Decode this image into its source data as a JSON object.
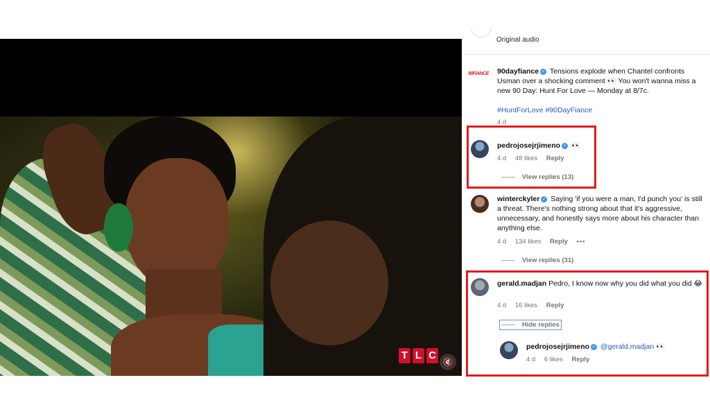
{
  "audio": {
    "label": "Original audio"
  },
  "video": {
    "badge_letters": [
      "T",
      "L",
      "C"
    ],
    "mute_icon": "muted-speaker-icon"
  },
  "caption": {
    "brand_avatar_text": "90FIANCE",
    "user": "90dayfiance",
    "text": "Tensions explode when Chantel confronts Usman over a shocking comment 👀 You won't wanna miss a new 90 Day: Hunt For Love — Monday at 8/7c.",
    "hashtags": "#HuntForLove #90DayFiance",
    "time": "4 d"
  },
  "comments": [
    {
      "user": "pedrojosejrjimeno",
      "text": "👀",
      "time": "4 d",
      "likes": "48 likes",
      "reply": "Reply",
      "replies_label": "View replies (13)"
    },
    {
      "user": "winterckyler",
      "text": "Saying 'if you were a man, I'd punch you' is still a threat. There's nothing strong about that it's aggressive, unnecessary, and honestly says more about his character than anything else.",
      "time": "4 d",
      "likes": "134 likes",
      "reply": "Reply",
      "more": "•••",
      "replies_label": "View replies (31)"
    },
    {
      "user": "gerald.madjan",
      "text": "Pedro, I know now why you did what you did 😂",
      "time": "4 d",
      "likes": "16 likes",
      "reply": "Reply",
      "replies_label": "Hide replies",
      "nested_reply": {
        "user": "pedrojosejrjimeno",
        "mention": "@gerald.madjan",
        "text": "👀",
        "time": "4 d",
        "likes": "6 likes",
        "reply": "Reply"
      }
    }
  ],
  "colors": {
    "highlight_box": "#e31b1b",
    "verified": "#3897f0",
    "hashtag": "#2a59b4"
  }
}
